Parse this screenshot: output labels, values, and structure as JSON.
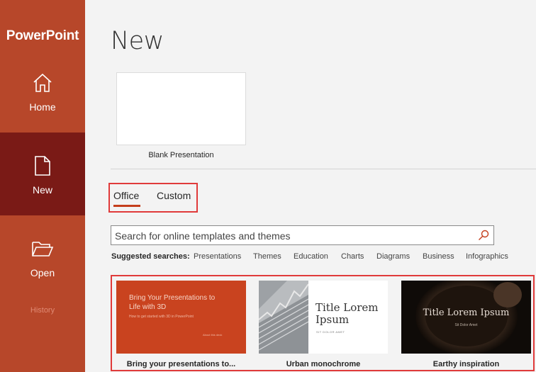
{
  "app": {
    "title": "PowerPoint"
  },
  "sidebar": {
    "items": [
      {
        "label": "Home",
        "icon": "home-icon"
      },
      {
        "label": "New",
        "icon": "new-document-icon",
        "selected": true
      },
      {
        "label": "Open",
        "icon": "open-folder-icon"
      }
    ],
    "history_label": "History"
  },
  "main": {
    "title": "New",
    "blank": {
      "label": "Blank Presentation"
    },
    "tabs": [
      {
        "label": "Office",
        "selected": true
      },
      {
        "label": "Custom",
        "selected": false
      }
    ],
    "search": {
      "placeholder": "Search for online templates and themes",
      "value": ""
    },
    "suggested": {
      "label": "Suggested searches:",
      "items": [
        "Presentations",
        "Themes",
        "Education",
        "Charts",
        "Diagrams",
        "Business",
        "Infographics"
      ]
    },
    "templates": [
      {
        "label": "Bring your presentations to...",
        "thumb_title": "Bring Your Presentations to Life with 3D",
        "thumb_sub": "How to get started with 3D in PowerPoint",
        "thumb_foot": "About this deck"
      },
      {
        "label": "Urban monochrome",
        "thumb_title": "Title Lorem Ipsum",
        "thumb_sub": "SIT DOLOR AMET"
      },
      {
        "label": "Earthy inspiration",
        "thumb_title": "Title Lorem Ipsum",
        "thumb_sub": "Sit Dolor Amet"
      }
    ]
  },
  "colors": {
    "sidebar": "#b7472a",
    "sidebar_selected": "#7a1a16",
    "accent": "#c43e1c",
    "highlight_box": "#e03a3a"
  }
}
